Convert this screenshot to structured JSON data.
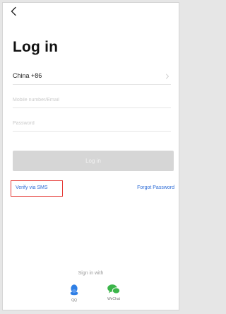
{
  "nav": {
    "back_icon": "chevron-left-icon"
  },
  "page": {
    "title": "Log in"
  },
  "form": {
    "country_code": "China +86",
    "country_chevron_icon": "chevron-right-icon",
    "mobile_placeholder": "Mobile number/Email",
    "password_placeholder": "Password",
    "login_label": "Log in"
  },
  "links": {
    "verify_sms": "Verify via SMS",
    "forgot_password": "Forgot Password"
  },
  "social": {
    "heading": "Sign in with",
    "providers": [
      {
        "label": "QQ",
        "icon": "qq-penguin-icon",
        "color": "#2f7fe5"
      },
      {
        "label": "WeChat",
        "icon": "wechat-bubbles-icon",
        "color": "#3bb54a"
      }
    ]
  },
  "colors": {
    "link": "#2c6bd6",
    "highlight_box": "#e53935",
    "login_button": "#d6d6d6"
  }
}
